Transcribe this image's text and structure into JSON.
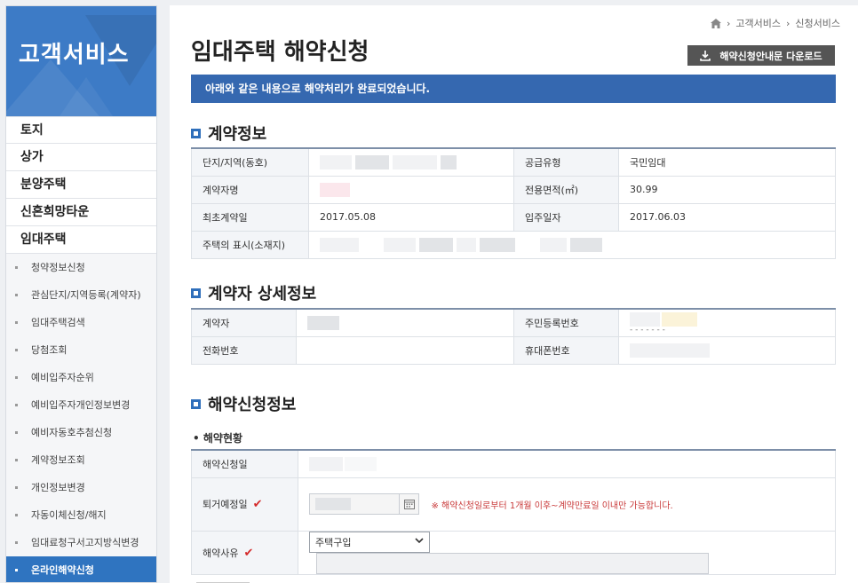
{
  "sidebar": {
    "title": "고객서비스",
    "main_items": [
      "토지",
      "상가",
      "분양주택",
      "신혼희망타운",
      "임대주택"
    ],
    "sub_items": [
      "청약정보신청",
      "관심단지/지역등록(계약자)",
      "임대주택검색",
      "당첨조회",
      "예비입주자순위",
      "예비입주자개인정보변경",
      "예비자동호추첨신청",
      "계약정보조회",
      "개인정보변경",
      "자동이체신청/해지",
      "임대료청구서고지방식변경",
      "온라인해약신청"
    ],
    "active_sub": "온라인해약신청"
  },
  "breadcrumb": {
    "level1": "고객서비스",
    "level2": "신청서비스"
  },
  "page": {
    "title": "임대주택 해약신청",
    "download_label": "해약신청안내문 다운로드",
    "notice": "아래와 같은 내용으로 해약처리가 완료되었습니다."
  },
  "contract": {
    "heading": "계약정보",
    "labels": {
      "complex": "단지/지역(동호)",
      "supply_type": "공급유형",
      "contractor": "계약자명",
      "area": "전용면적(㎡)",
      "first_date": "최초계약일",
      "move_in": "입주일자",
      "address": "주택의 표시(소재지)"
    },
    "values": {
      "supply_type": "국민임대",
      "area": "30.99",
      "first_date": "2017.05.08",
      "move_in": "2017.06.03"
    }
  },
  "contractor": {
    "heading": "계약자 상세정보",
    "labels": {
      "name": "계약자",
      "rrn": "주민등록번호",
      "phone": "전화번호",
      "mobile": "휴대폰번호"
    },
    "rrn_masked": "- - - - - - -"
  },
  "apply": {
    "heading": "해약신청정보",
    "subheading": "해약현황",
    "labels": {
      "apply_date": "해약신청일",
      "leave_date": "퇴거예정일",
      "reason": "해약사유"
    },
    "check_mark": "✔",
    "warning": "※ 해약신청일로부터 1개월 이후~계약만료일 이내만 가능합니다.",
    "reason_value": "주택구입"
  },
  "colors": {
    "accent": "#2f74c0",
    "notice_bg": "#3568b0",
    "warn": "#c93a3a"
  }
}
